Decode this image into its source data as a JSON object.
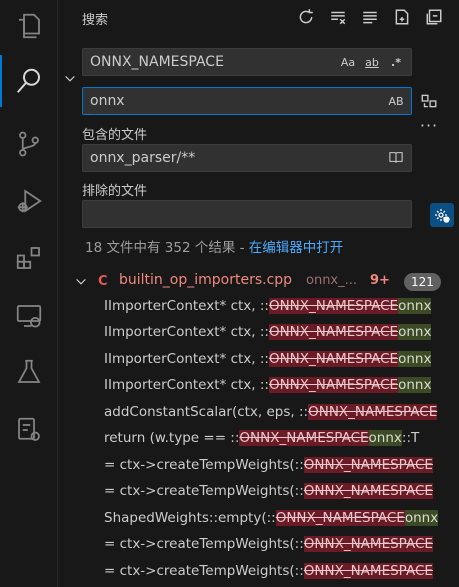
{
  "header": {
    "title": "搜索"
  },
  "search": {
    "value": "ONNX_NAMESPACE",
    "opt_case": "Aa",
    "opt_word": "ab",
    "opt_regex": ".*"
  },
  "replace": {
    "value": "onnx",
    "opt_preserve": "AB"
  },
  "include": {
    "label": "包含的文件",
    "value": "onnx_parser/**"
  },
  "exclude": {
    "label": "排除的文件",
    "value": ""
  },
  "summary": {
    "text": "18 文件中有 352 个结果 - ",
    "link": "在编辑器中打开"
  },
  "file": {
    "icon": "C",
    "name": "builtin_op_importers.cpp",
    "path": "onnx_...",
    "problems": "9+",
    "count": "121"
  },
  "matches": [
    {
      "pre": "IImporterContext* ctx, ::",
      "del": "ONNX_NAMESPACE",
      "ins": "onnx",
      "post": ""
    },
    {
      "pre": "IImporterContext* ctx, ::",
      "del": "ONNX_NAMESPACE",
      "ins": "onnx",
      "post": ""
    },
    {
      "pre": "IImporterContext* ctx, ::",
      "del": "ONNX_NAMESPACE",
      "ins": "onnx",
      "post": ""
    },
    {
      "pre": "IImporterContext* ctx, ::",
      "del": "ONNX_NAMESPACE",
      "ins": "onnx",
      "post": ""
    },
    {
      "pre": "addConstantScalar(ctx, eps, ::",
      "del": "ONNX_NAMESPACE",
      "ins": "",
      "post": ""
    },
    {
      "pre": "return (w.type == ::",
      "del": "ONNX_NAMESPACE",
      "ins": "onnx",
      "post": "::T"
    },
    {
      "pre": "= ctx->createTempWeights(::",
      "del": "ONNX_NAMESPACE",
      "ins": "",
      "post": ""
    },
    {
      "pre": "= ctx->createTempWeights(::",
      "del": "ONNX_NAMESPACE",
      "ins": "",
      "post": ""
    },
    {
      "pre": "ShapedWeights::empty(::",
      "del": "ONNX_NAMESPACE",
      "ins": "onnx",
      "post": ""
    },
    {
      "pre": "= ctx->createTempWeights(::",
      "del": "ONNX_NAMESPACE",
      "ins": "",
      "post": ""
    },
    {
      "pre": "= ctx->createTempWeights(::",
      "del": "ONNX_NAMESPACE",
      "ins": "",
      "post": ""
    }
  ],
  "colors": {
    "accent": "#0078d4",
    "link": "#4daafc",
    "error": "#f1897f",
    "deleted_bg": "#6b1b25",
    "inserted_bg": "#3c4a25"
  }
}
